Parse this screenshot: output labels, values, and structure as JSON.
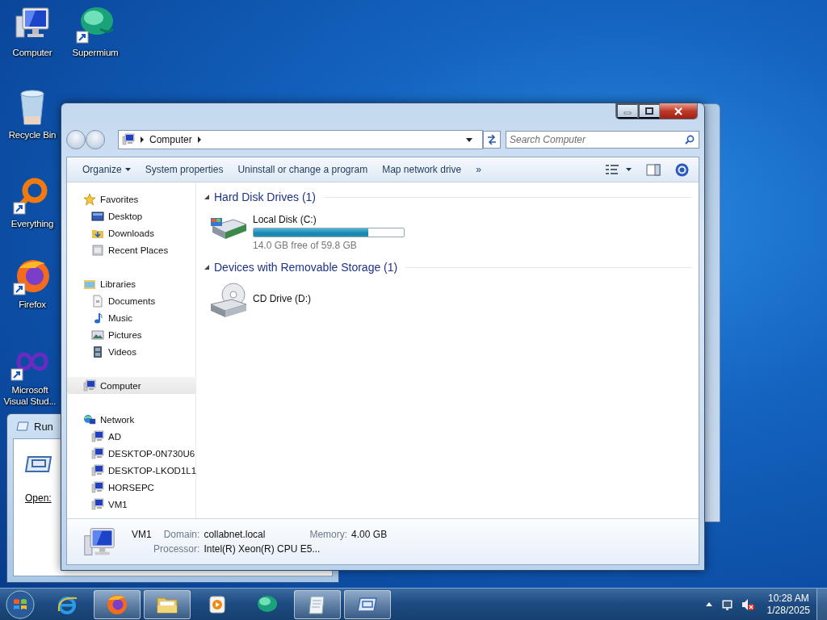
{
  "desktop_icons": [
    {
      "label": "Computer",
      "kind": "computer",
      "shortcut": false
    },
    {
      "label": "Supermium",
      "kind": "sphere",
      "shortcut": true
    },
    {
      "label": "Recycle Bin",
      "kind": "recycle",
      "shortcut": false
    },
    {
      "label": "Everything",
      "kind": "ring",
      "shortcut": true
    },
    {
      "label": "Firefox",
      "kind": "fox",
      "shortcut": true
    },
    {
      "label": "Microsoft Visual Stud...",
      "kind": "infinity",
      "shortcut": true
    }
  ],
  "run_dialog": {
    "title": "Run",
    "open_label": "Open:"
  },
  "explorer": {
    "address": [
      "Computer"
    ],
    "search": {
      "placeholder": "Search Computer"
    },
    "toolbar": [
      {
        "label": "Organize",
        "dropdown": true
      },
      {
        "label": "System properties",
        "dropdown": false
      },
      {
        "label": "Uninstall or change a program",
        "dropdown": false
      },
      {
        "label": "Map network drive",
        "dropdown": false
      },
      {
        "label": "»",
        "dropdown": false
      }
    ],
    "nav": [
      {
        "label": "Favorites",
        "kind": "star",
        "selected": false,
        "children": [
          {
            "label": "Desktop",
            "kind": "desktop",
            "selected": false
          },
          {
            "label": "Downloads",
            "kind": "downloads",
            "selected": false
          },
          {
            "label": "Recent Places",
            "kind": "recent",
            "selected": false
          }
        ]
      },
      {
        "label": "Libraries",
        "kind": "libraries",
        "selected": false,
        "children": [
          {
            "label": "Documents",
            "kind": "documents",
            "selected": false
          },
          {
            "label": "Music",
            "kind": "music",
            "selected": false
          },
          {
            "label": "Pictures",
            "kind": "pictures",
            "selected": false
          },
          {
            "label": "Videos",
            "kind": "videos",
            "selected": false
          }
        ]
      },
      {
        "label": "Computer",
        "kind": "computer",
        "selected": true
      },
      {
        "label": "Network",
        "kind": "network",
        "selected": false,
        "children": [
          {
            "label": "AD",
            "kind": "computer",
            "selected": false
          },
          {
            "label": "DESKTOP-0N730U6",
            "kind": "computer",
            "selected": false
          },
          {
            "label": "DESKTOP-LKOD1L1",
            "kind": "computer",
            "selected": false
          },
          {
            "label": "HORSEPC",
            "kind": "computer",
            "selected": false
          },
          {
            "label": "VM1",
            "kind": "computer",
            "selected": false
          }
        ]
      }
    ],
    "groups": [
      {
        "title": "Hard Disk Drives (1)",
        "expanded": true,
        "items": [
          {
            "name": "Local Disk (C:)",
            "kind": "hdd",
            "level": 0.766,
            "free": "14.0 GB free of 59.8 GB"
          }
        ]
      },
      {
        "title": "Devices with Removable Storage (1)",
        "expanded": true,
        "items": [
          {
            "name": "CD Drive (D:)",
            "kind": "cd"
          }
        ]
      }
    ],
    "details": {
      "name": "VM1",
      "fields": [
        {
          "label": "Domain:",
          "value": "collabnet.local"
        },
        {
          "label": "Memory:",
          "value": "4.00 GB"
        },
        {
          "label": "Processor:",
          "value": "Intel(R) Xeon(R) CPU E5..."
        }
      ]
    }
  },
  "taskbar": {
    "items": [
      {
        "kind": "ie",
        "open": false
      },
      {
        "kind": "fox",
        "open": true
      },
      {
        "kind": "folder",
        "open": true
      },
      {
        "kind": "media",
        "open": false
      },
      {
        "kind": "sphere",
        "open": false
      },
      {
        "kind": "notepad",
        "open": true
      },
      {
        "kind": "run",
        "open": true
      }
    ],
    "time": "10:28 AM",
    "date": "1/28/2025"
  }
}
